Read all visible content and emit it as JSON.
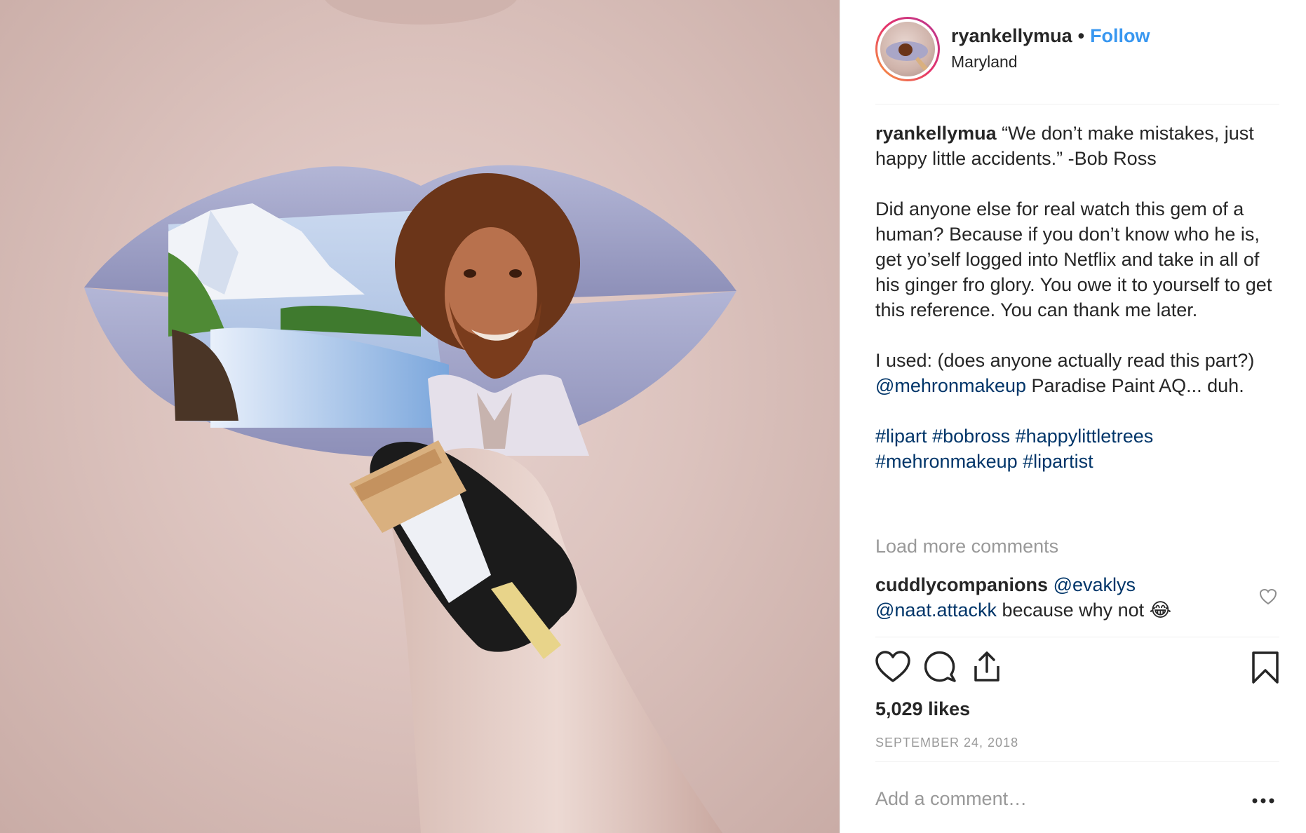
{
  "post": {
    "image_alt": "Lip art painting of Bob Ross with a landscape, finger with painted brush nail",
    "header": {
      "username": "ryankellymua",
      "separator": "•",
      "follow_label": "Follow",
      "location": "Maryland"
    },
    "caption": {
      "username": "ryankellymua",
      "quote": "“We don’t make mistakes, just happy little accidents.” -Bob Ross",
      "paragraph2": "Did anyone else for real watch this gem of a human? Because if you don’t know who he is, get yo’self logged into Netflix and take in all of his ginger fro glory. You owe it to yourself to get this reference. You can thank me later.",
      "paragraph3_prefix": "I used: (does anyone actually read this part?) ",
      "paragraph3_mention": "@mehronmakeup",
      "paragraph3_suffix": " Paradise Paint AQ... duh.",
      "hashtags": [
        "#lipart",
        "#bobross",
        "#happylittletrees",
        "#mehronmakeup",
        "#lipartist"
      ]
    },
    "load_more_label": "Load more comments",
    "comment": {
      "username": "cuddlycompanions",
      "mention1": "@evaklys",
      "mention2": "@naat.attackk",
      "text": " because why not 😂"
    },
    "likes_label": "5,029 likes",
    "date_label": "SEPTEMBER 24, 2018",
    "add_comment_placeholder": "Add a comment…",
    "icons": {
      "like": "heart-icon",
      "comment": "comment-icon",
      "share": "share-icon",
      "save": "bookmark-icon",
      "more": "more-dots-icon",
      "comment_like": "small-heart-icon"
    },
    "colors": {
      "follow": "#3897f0",
      "link": "#003569",
      "muted": "#999999",
      "text": "#262626"
    }
  }
}
